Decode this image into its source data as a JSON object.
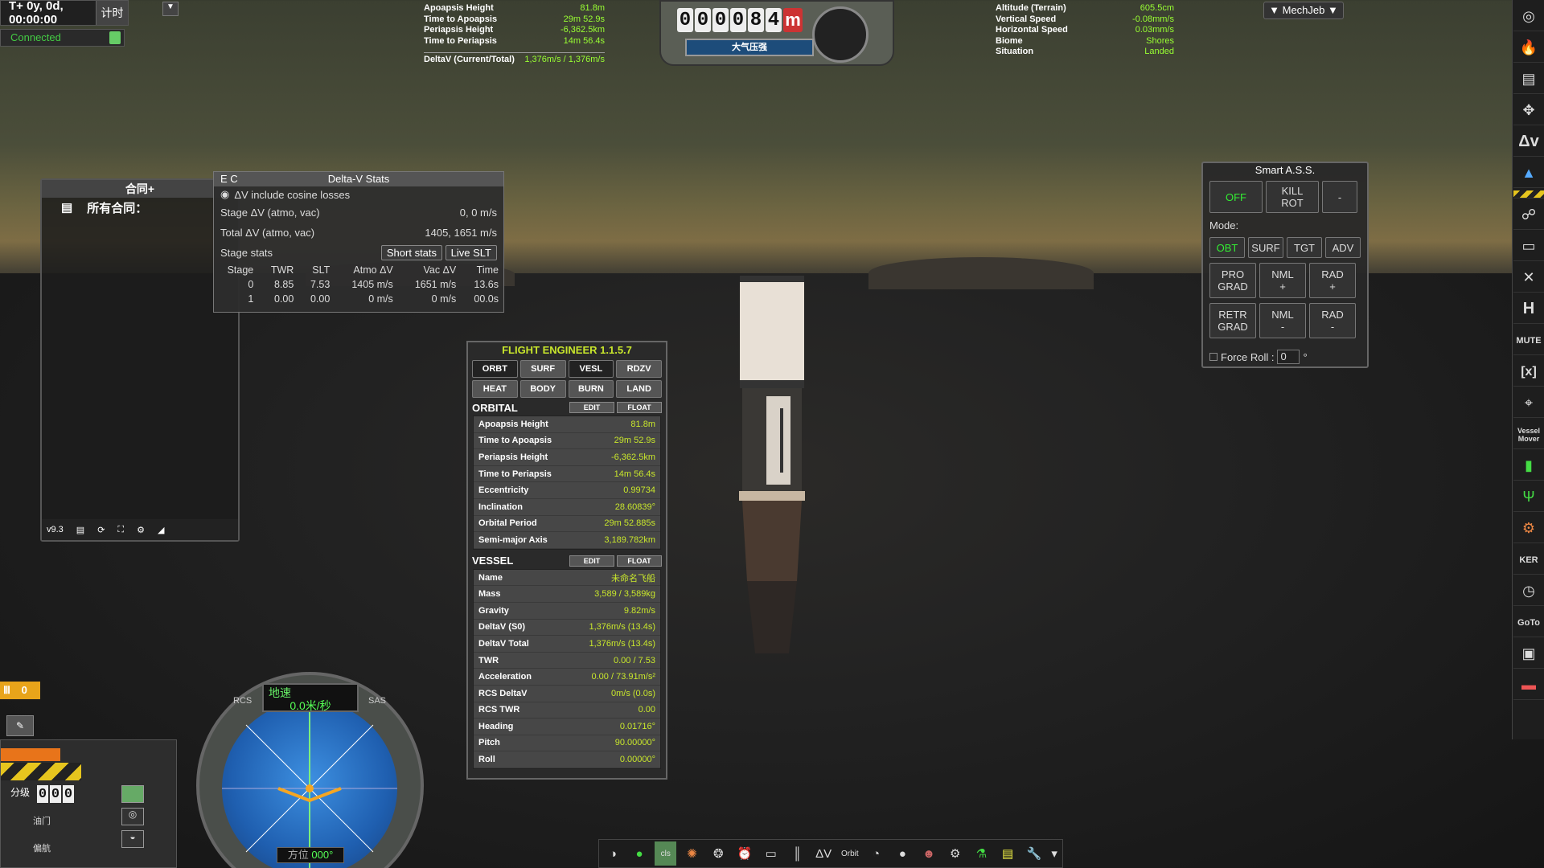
{
  "met": {
    "time": "T+ 0y, 0d, 00:00:00",
    "timer_button": "计时"
  },
  "connection": {
    "status": "Connected"
  },
  "orbit_readout": [
    {
      "label": "Apoapsis Height",
      "value": "81.8m"
    },
    {
      "label": "Time to Apoapsis",
      "value": "29m 52.9s"
    },
    {
      "label": "Periapsis Height",
      "value": "-6,362.5km"
    },
    {
      "label": "Time to Periapsis",
      "value": "14m 56.4s"
    }
  ],
  "deltav_total": {
    "label": "DeltaV (Current/Total)",
    "value": "1,376m/s / 1,376m/s"
  },
  "altimeter": {
    "digits": [
      "0",
      "0",
      "0",
      "0",
      "8",
      "4"
    ],
    "unit": "m",
    "bar_label": "大气压强"
  },
  "surface_readout": [
    {
      "label": "Altitude (Terrain)",
      "value": "605.5cm"
    },
    {
      "label": "Vertical Speed",
      "value": "-0.08mm/s"
    },
    {
      "label": "Horizontal Speed",
      "value": "0.03mm/s"
    },
    {
      "label": "Biome",
      "value": "Shores"
    },
    {
      "label": "Situation",
      "value": "Landed"
    }
  ],
  "mechjeb": {
    "label": "▼ MechJeb ▼"
  },
  "contracts": {
    "header": "合同+",
    "subheader": "所有合同：",
    "version": "v9.3"
  },
  "deltav_stats": {
    "header_left": "E C",
    "title": "Delta-V Stats",
    "cosine_label": "ΔV include cosine losses",
    "stage_dv_label": "Stage ΔV (atmo, vac)",
    "stage_dv_value": "0, 0 m/s",
    "total_dv_label": "Total ΔV (atmo, vac)",
    "total_dv_value": "1405, 1651 m/s",
    "stage_stats_label": "Stage stats",
    "short_stats_button": "Short stats",
    "live_slt_button": "Live SLT",
    "columns": [
      "Stage",
      "TWR",
      "SLT",
      "Atmo ΔV",
      "Vac ΔV",
      "Time"
    ],
    "rows": [
      [
        "0",
        "8.85",
        "7.53",
        "1405 m/s",
        "1651 m/s",
        "13.6s"
      ],
      [
        "1",
        "0.00",
        "0.00",
        "0 m/s",
        "0 m/s",
        "00.0s"
      ]
    ]
  },
  "flight_engineer": {
    "title": "FLIGHT ENGINEER 1.1.5.7",
    "tabs": [
      "ORBT",
      "SURF",
      "VESL",
      "RDZV",
      "HEAT",
      "BODY",
      "BURN",
      "LAND"
    ],
    "edit_label": "EDIT",
    "float_label": "FLOAT",
    "orbital_title": "ORBITAL",
    "orbital": [
      {
        "label": "Apoapsis Height",
        "value": "81.8m"
      },
      {
        "label": "Time to Apoapsis",
        "value": "29m 52.9s"
      },
      {
        "label": "Periapsis Height",
        "value": "-6,362.5km"
      },
      {
        "label": "Time to Periapsis",
        "value": "14m 56.4s"
      },
      {
        "label": "Eccentricity",
        "value": "0.99734"
      },
      {
        "label": "Inclination",
        "value": "28.60839°"
      },
      {
        "label": "Orbital Period",
        "value": "29m 52.885s"
      },
      {
        "label": "Semi-major Axis",
        "value": "3,189.782km"
      }
    ],
    "vessel_title": "VESSEL",
    "vessel": [
      {
        "label": "Name",
        "value": "未命名飞船"
      },
      {
        "label": "Mass",
        "value": "3,589 / 3,589kg"
      },
      {
        "label": "Gravity",
        "value": "9.82m/s"
      },
      {
        "label": "DeltaV (S0)",
        "value": "1,376m/s (13.4s)"
      },
      {
        "label": "DeltaV Total",
        "value": "1,376m/s (13.4s)"
      },
      {
        "label": "TWR",
        "value": "0.00 / 7.53"
      },
      {
        "label": "Acceleration",
        "value": "0.00 / 73.91m/s²"
      },
      {
        "label": "RCS DeltaV",
        "value": "0m/s (0.0s)"
      },
      {
        "label": "RCS TWR",
        "value": "0.00"
      },
      {
        "label": "Heading",
        "value": "0.01716°"
      },
      {
        "label": "Pitch",
        "value": "90.00000°"
      },
      {
        "label": "Roll",
        "value": "0.00000°"
      }
    ]
  },
  "smart_ass": {
    "title": "Smart A.S.S.",
    "off": "OFF",
    "kill_rot_1": "KILL",
    "kill_rot_2": "ROT",
    "dash": "-",
    "mode_label": "Mode:",
    "modes": [
      "OBT",
      "SURF",
      "TGT",
      "ADV"
    ],
    "row1": [
      [
        "PRO",
        "GRAD"
      ],
      [
        "NML",
        "+"
      ],
      [
        "RAD",
        "+"
      ]
    ],
    "row2": [
      [
        "RETR",
        "GRAD"
      ],
      [
        "NML",
        "-"
      ],
      [
        "RAD",
        "-"
      ]
    ],
    "force_roll_label": "Force Roll :",
    "force_roll_value": "0",
    "degree": "°",
    "accent": "#33ee33"
  },
  "navball": {
    "speed_label": "地速",
    "speed": "0.0米/秒",
    "heading_label": "方位",
    "heading": "000°",
    "rcs": "RCS",
    "sas": "SAS"
  },
  "staging": {
    "count_badge": "0",
    "stage_label": "分级",
    "stage_digits": [
      "0",
      "0",
      "0"
    ],
    "throttle_label": "油门",
    "other_label": "偏航"
  },
  "toolbar": {
    "dv_label": "ΔV",
    "orbit_label": "Orbit",
    "cls_label": "cls"
  },
  "sidebar": {
    "mute": "MUTE",
    "x_label": "[x]",
    "ker": "KER",
    "goto": "GoTo",
    "vessel_mover": "Vessel Mover",
    "h_label": "H",
    "dv": "Δv"
  }
}
